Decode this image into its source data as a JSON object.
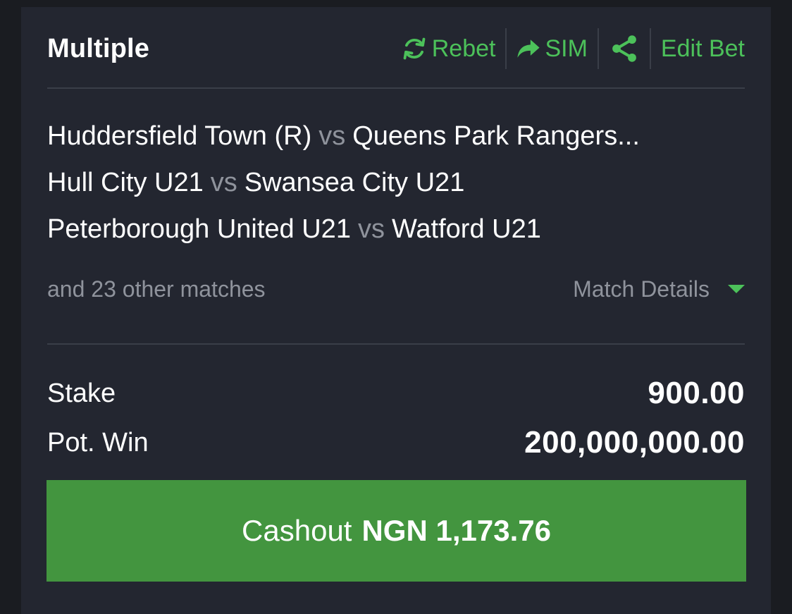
{
  "header": {
    "title": "Multiple",
    "actions": {
      "rebet": "Rebet",
      "sim": "SIM",
      "edit_bet": "Edit Bet"
    }
  },
  "matches": [
    {
      "home": "Huddersfield Town (R)",
      "vs": "vs",
      "away": "Queens Park Rangers..."
    },
    {
      "home": "Hull City U21",
      "vs": "vs",
      "away": "Swansea City U21"
    },
    {
      "home": "Peterborough United U21",
      "vs": "vs",
      "away": "Watford U21"
    }
  ],
  "other_matches": "and 23 other matches",
  "match_details": "Match Details",
  "stake": {
    "label": "Stake",
    "value": "900.00"
  },
  "pot_win": {
    "label": "Pot. Win",
    "value": "200,000,000.00"
  },
  "cashout": {
    "label": "Cashout",
    "amount": "NGN 1,173.76"
  },
  "colors": {
    "background": "#1a1c21",
    "card": "#232630",
    "accent": "#4cc15a",
    "cashout_button": "#43953f",
    "muted_text": "#8f939c"
  },
  "icons": [
    "refresh-icon",
    "share-arrow-icon",
    "share-nodes-icon",
    "caret-down-icon"
  ]
}
